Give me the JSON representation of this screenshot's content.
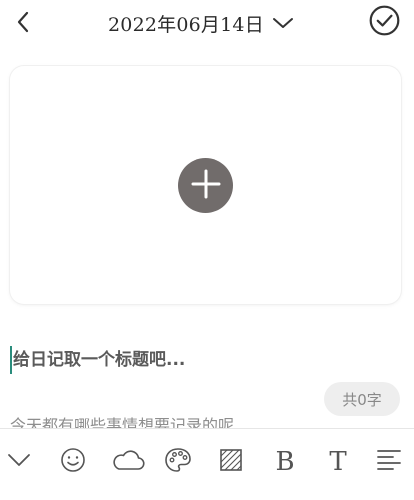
{
  "header": {
    "date": "2022年06月14日",
    "back_icon": "chevron-left-icon",
    "date_dropdown_icon": "chevron-down-icon",
    "confirm_icon": "check-circle-icon"
  },
  "image_area": {
    "add_icon": "plus-circle-icon",
    "button_color": "#716c6b"
  },
  "editor": {
    "title_placeholder": "给日记取一个标题吧...",
    "body_placeholder": "今天都有哪些事情想要记录的呢",
    "word_count": "共0字",
    "caret_color": "#2a8c7c"
  },
  "toolbar": {
    "items": [
      {
        "icon": "collapse-keyboard-icon"
      },
      {
        "icon": "emoji-icon"
      },
      {
        "icon": "weather-icon"
      },
      {
        "icon": "palette-icon"
      },
      {
        "icon": "background-pattern-icon"
      },
      {
        "icon": "bold-icon",
        "label": "B"
      },
      {
        "icon": "text-size-icon",
        "label": "T"
      },
      {
        "icon": "align-icon"
      }
    ]
  }
}
